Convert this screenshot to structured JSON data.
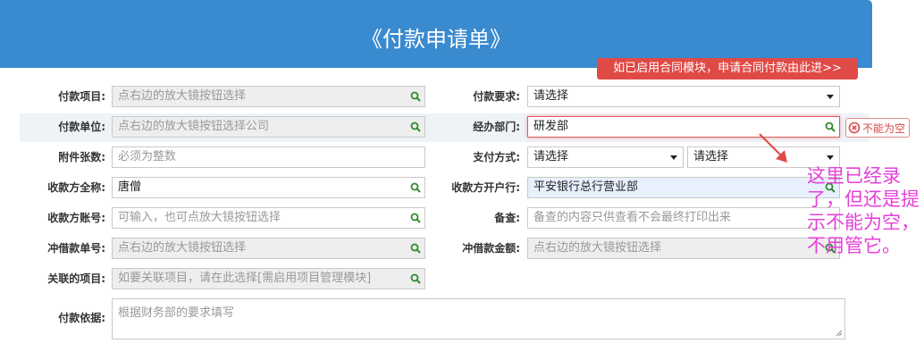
{
  "header": {
    "title": "《付款申请单》"
  },
  "contract_link": "如已启用合同模块，申请合同付款由此进>>",
  "fields": {
    "project": {
      "label": "付款项目:",
      "placeholder": "点右边的放大镜按钮选择"
    },
    "requirement": {
      "label": "付款要求:",
      "value": "请选择"
    },
    "unit": {
      "label": "付款单位:",
      "placeholder": "点右边的放大镜按钮选择公司"
    },
    "department": {
      "label": "经办部门:",
      "value": "研发部"
    },
    "attachments": {
      "label": "附件张数:",
      "placeholder": "必须为整数"
    },
    "pay_method": {
      "label": "支付方式:",
      "value1": "请选择",
      "value2": "请选择"
    },
    "payee_name": {
      "label": "收款方全称:",
      "value": "唐僧"
    },
    "payee_bank": {
      "label": "收款方开户行:",
      "value": "平安银行总行营业部"
    },
    "payee_account": {
      "label": "收款方账号:",
      "placeholder": "可输入，也可点放大镜按钮选择"
    },
    "remarks": {
      "label": "备查:",
      "placeholder": "备查的内容只供查看不会最终打印出来"
    },
    "offset_doc": {
      "label": "冲借款单号:",
      "placeholder": "点右边的放大镜按钮选择"
    },
    "offset_amount": {
      "label": "冲借款金额:",
      "placeholder": "点右边的放大镜按钮选择"
    },
    "related_project": {
      "label": "关联的项目:",
      "placeholder": "如要关联项目，请在此选择[需启用项目管理模块]"
    },
    "basis": {
      "label": "付款依据:",
      "placeholder": "根据财务部的要求填写"
    }
  },
  "validation": {
    "message": "不能为空"
  },
  "annotation": "这里已经录了，但还是提示不能为空，不用管它。",
  "colors": {
    "header": "#3a8ad0",
    "link_bg": "#e04a46",
    "error": "#e05c5c",
    "annotation": "#e640d8",
    "magnifier": "#2e8b2e"
  }
}
